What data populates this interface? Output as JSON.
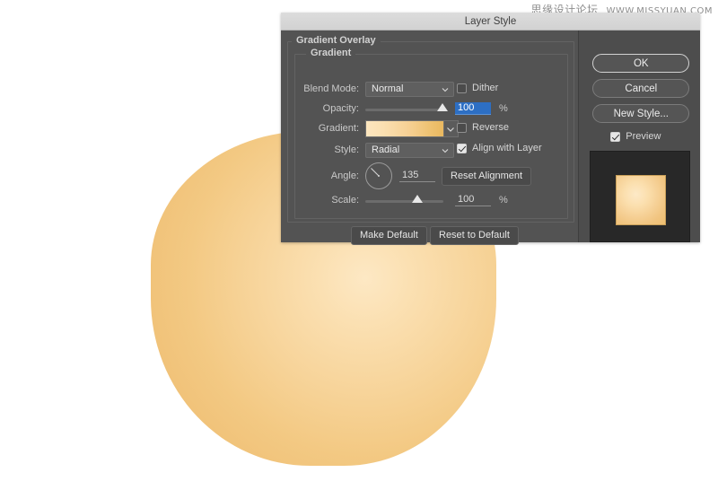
{
  "canvas": {
    "artwork_name": "rounded-blob-shape",
    "gradient_center_color": "#fde8c4",
    "gradient_edge_color": "#eec071",
    "background_color": "#ffffff"
  },
  "watermark": {
    "chinese": "思缘设计论坛",
    "url": "WWW.MISSYUAN.COM"
  },
  "dialog": {
    "title": "Layer Style",
    "groups": {
      "outer_label": "Gradient Overlay",
      "inner_label": "Gradient"
    },
    "fields": {
      "blend_mode": {
        "label": "Blend Mode:",
        "value": "Normal"
      },
      "opacity": {
        "label": "Opacity:",
        "value": "100",
        "unit": "%"
      },
      "gradient": {
        "label": "Gradient:",
        "swatch_start": "#fce6bf",
        "swatch_end": "#e9b85f"
      },
      "style": {
        "label": "Style:",
        "value": "Radial"
      },
      "angle": {
        "label": "Angle:",
        "value": "135",
        "unit": "°"
      },
      "scale": {
        "label": "Scale:",
        "value": "100",
        "unit": "%"
      }
    },
    "checkboxes": {
      "dither": {
        "label": "Dither",
        "checked": false
      },
      "reverse": {
        "label": "Reverse",
        "checked": false
      },
      "align_with_layer": {
        "label": "Align with Layer",
        "checked": true
      },
      "preview": {
        "label": "Preview",
        "checked": true
      }
    },
    "buttons": {
      "reset_alignment": "Reset Alignment",
      "make_default": "Make Default",
      "reset_to_default": "Reset to Default",
      "ok": "OK",
      "cancel": "Cancel",
      "new_style": "New Style..."
    },
    "preview_thumbnail": {
      "name": "gradient-preview-swatch",
      "background_color": "#282828",
      "swatch_center": "#fde9c7",
      "swatch_edge": "#eebe70"
    },
    "colors": {
      "dialog_body": "#535353",
      "titlebar": "#dcdcdc",
      "selection_blue": "#2d6fc4"
    }
  }
}
